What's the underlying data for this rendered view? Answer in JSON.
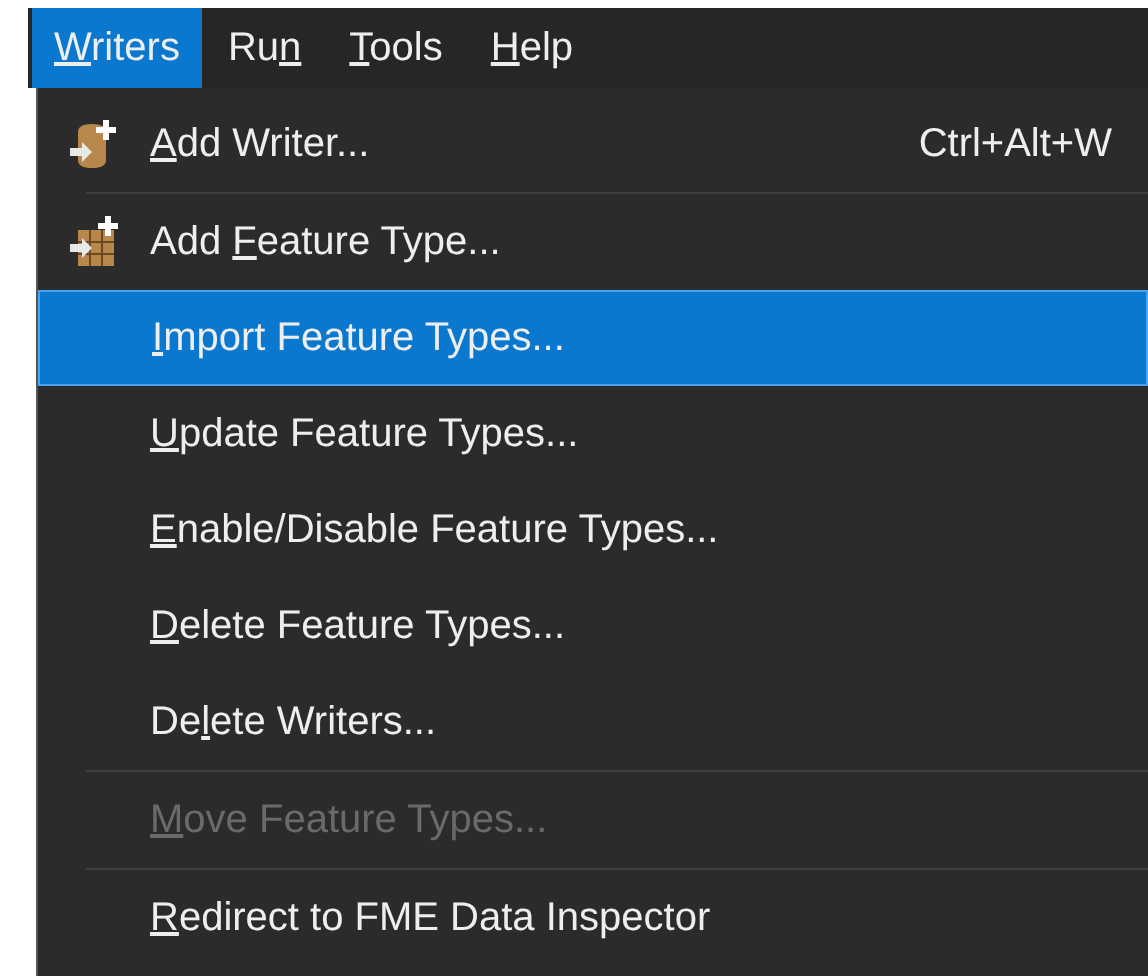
{
  "menubar": [
    {
      "key": "W",
      "after": "riters",
      "selected": true
    },
    {
      "before": "Ru",
      "key": "n",
      "selected": false
    },
    {
      "key": "T",
      "after": "ools",
      "selected": false
    },
    {
      "key": "H",
      "after": "elp",
      "selected": false
    }
  ],
  "menu": {
    "items": [
      {
        "kind": "writer",
        "key": "A",
        "after": "dd Writer...",
        "shortcut": "Ctrl+Alt+W",
        "selected": false,
        "disabled": false,
        "separator_after": true
      },
      {
        "kind": "feature-type",
        "before": "Add ",
        "key": "F",
        "after": "eature Type...",
        "selected": false,
        "disabled": false,
        "separator_after": false
      },
      {
        "kind": "plain",
        "key": "I",
        "after": "mport Feature Types...",
        "selected": true,
        "disabled": false,
        "separator_after": false
      },
      {
        "kind": "plain",
        "key": "U",
        "after": "pdate Feature Types...",
        "selected": false,
        "disabled": false,
        "separator_after": false
      },
      {
        "kind": "plain",
        "key": "E",
        "after": "nable/Disable Feature Types...",
        "selected": false,
        "disabled": false,
        "separator_after": false
      },
      {
        "kind": "plain",
        "key": "D",
        "after": "elete Feature Types...",
        "selected": false,
        "disabled": false,
        "separator_after": false
      },
      {
        "kind": "plain",
        "before": "De",
        "key": "l",
        "after": "ete Writers...",
        "selected": false,
        "disabled": false,
        "separator_after": true
      },
      {
        "kind": "plain",
        "key": "M",
        "after": "ove Feature Types...",
        "selected": false,
        "disabled": true,
        "separator_after": true
      },
      {
        "kind": "plain",
        "key": "R",
        "after": "edirect to FME Data Inspector",
        "selected": false,
        "disabled": false,
        "separator_after": false
      }
    ]
  }
}
